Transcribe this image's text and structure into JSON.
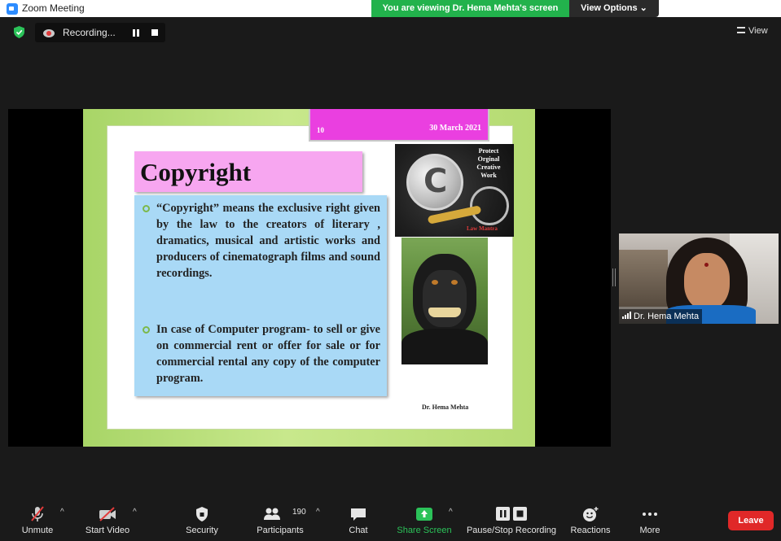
{
  "window": {
    "title": "Zoom Meeting"
  },
  "banner": {
    "viewing_text": "You are viewing Dr. Hema Mehta's screen",
    "view_options": "View Options ⌄"
  },
  "top_bar": {
    "recording_label": "Recording...",
    "view_label": "View"
  },
  "slide": {
    "number": "10",
    "date": "30 March 2021",
    "title": "Copyright",
    "bullets": [
      "“Copyright” means the exclusive right given by the law to the creators of literary , dramatics, musical and artistic works and producers of cinematograph films and sound recordings.",
      "In case of Computer program- to sell or give on commercial rent or offer for sale or for commercial rental any copy of the computer program."
    ],
    "image_caption": "Protect Orginal Creative Work",
    "signature": "Dr. Hema Mehta"
  },
  "participant_video": {
    "name": "Dr. Hema Mehta"
  },
  "toolbar": {
    "unmute": "Unmute",
    "start_video": "Start Video",
    "security": "Security",
    "participants": "Participants",
    "participant_count": "190",
    "chat": "Chat",
    "share_screen": "Share Screen",
    "pause_stop_recording": "Pause/Stop Recording",
    "reactions": "Reactions",
    "more": "More",
    "leave": "Leave"
  },
  "colors": {
    "banner_green": "#22b24c",
    "share_green": "#2bc259",
    "leave_red": "#e02828",
    "slide_title_pink": "#f7a6f0",
    "slide_body_blue": "#a9d9f6",
    "slide_header_magenta": "#ea3fe0"
  }
}
